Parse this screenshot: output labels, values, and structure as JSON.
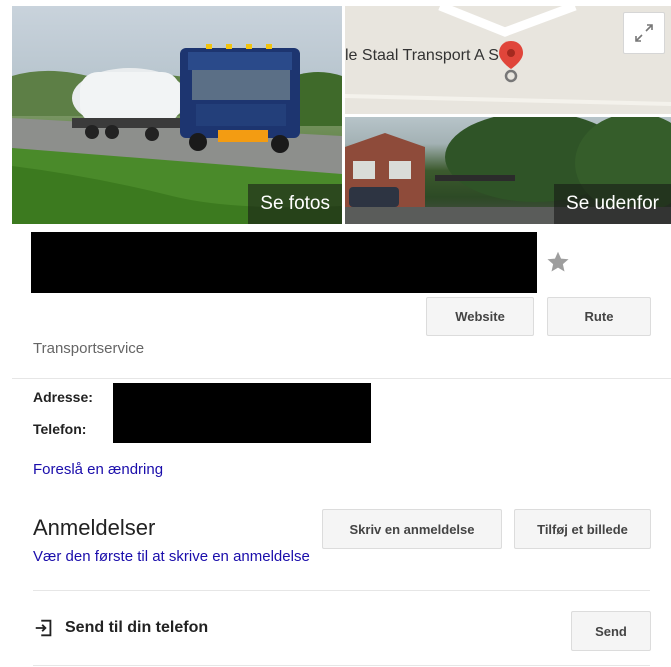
{
  "photos": {
    "main_label": "Se fotos",
    "street_label": "Se udenfor",
    "map_caption": "le Staal Transport A S",
    "expand_icon": "expand-arrows-icon"
  },
  "business": {
    "category": "Transportservice",
    "star_icon": "star-icon"
  },
  "buttons": {
    "website": "Website",
    "route": "Rute"
  },
  "details": {
    "address_label": "Adresse:",
    "phone_label": "Telefon:",
    "suggest_edit": "Foreslå en ændring"
  },
  "reviews": {
    "title": "Anmeldelser",
    "write_review": "Skriv en anmeldelse",
    "add_photo": "Tilføj et billede",
    "first_review_link": "Vær den første til at skrive en anmeldelse"
  },
  "send": {
    "label": "Send til din telefon",
    "button": "Send",
    "icon": "send-to-phone-icon"
  },
  "colors": {
    "link": "#1a0dab",
    "map_pin": "#e0453a"
  }
}
